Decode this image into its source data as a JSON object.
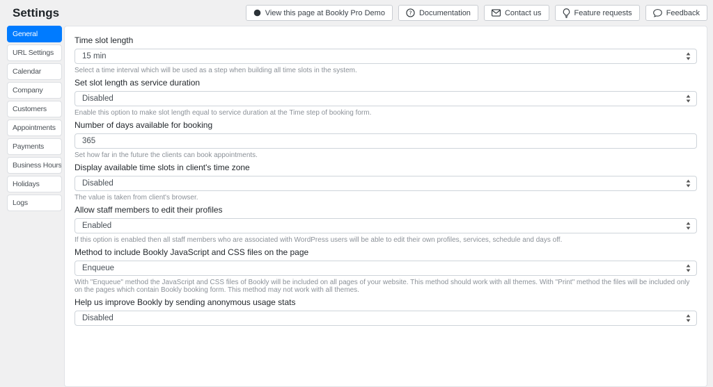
{
  "title": "Settings",
  "header": {
    "buttons": [
      {
        "label": "View this page at Bookly Pro Demo",
        "icon": "bookly-demo-icon"
      },
      {
        "label": "Documentation",
        "icon": "question-circle-icon"
      },
      {
        "label": "Contact us",
        "icon": "envelope-icon"
      },
      {
        "label": "Feature requests",
        "icon": "lightbulb-icon"
      },
      {
        "label": "Feedback",
        "icon": "chat-bubble-icon"
      }
    ]
  },
  "sidebar": {
    "items": [
      {
        "label": "General",
        "active": true
      },
      {
        "label": "URL Settings",
        "active": false
      },
      {
        "label": "Calendar",
        "active": false
      },
      {
        "label": "Company",
        "active": false
      },
      {
        "label": "Customers",
        "active": false
      },
      {
        "label": "Appointments",
        "active": false
      },
      {
        "label": "Payments",
        "active": false
      },
      {
        "label": "Business Hours",
        "active": false
      },
      {
        "label": "Holidays",
        "active": false
      },
      {
        "label": "Logs",
        "active": false
      }
    ]
  },
  "form": {
    "fields": [
      {
        "label": "Time slot length",
        "control": "select",
        "value": "15 min",
        "help": "Select a time interval which will be used as a step when building all time slots in the system."
      },
      {
        "label": "Set slot length as service duration",
        "control": "select",
        "value": "Disabled",
        "help": "Enable this option to make slot length equal to service duration at the Time step of booking form."
      },
      {
        "label": "Number of days available for booking",
        "control": "input",
        "value": "365",
        "help": "Set how far in the future the clients can book appointments."
      },
      {
        "label": "Display available time slots in client's time zone",
        "control": "select",
        "value": "Disabled",
        "help": "The value is taken from client's browser."
      },
      {
        "label": "Allow staff members to edit their profiles",
        "control": "select",
        "value": "Enabled",
        "help": "If this option is enabled then all staff members who are associated with WordPress users will be able to edit their own profiles, services, schedule and days off."
      },
      {
        "label": "Method to include Bookly JavaScript and CSS files on the page",
        "control": "select",
        "value": "Enqueue",
        "help": "With \"Enqueue\" method the JavaScript and CSS files of Bookly will be included on all pages of your website. This method should work with all themes. With \"Print\" method the files will be included only on the pages which contain Bookly booking form. This method may not work with all themes."
      },
      {
        "label": "Help us improve Bookly by sending anonymous usage stats",
        "control": "select",
        "value": "Disabled",
        "help": ""
      }
    ]
  },
  "colors": {
    "accent": "#007bff",
    "page_background": "#f0f0f1",
    "panel_background": "#ffffff",
    "border": "#ced4da",
    "help_text": "#8b9198"
  }
}
